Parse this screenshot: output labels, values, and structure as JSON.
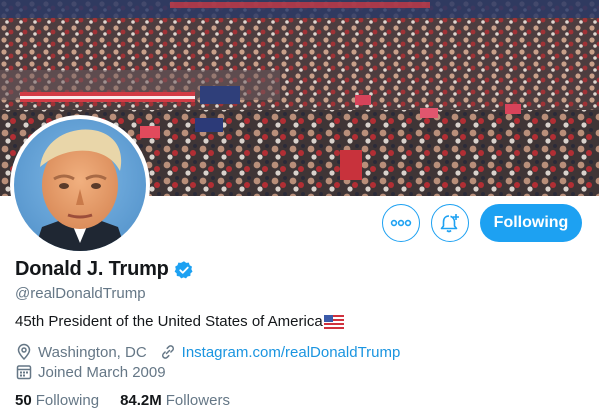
{
  "banner": {
    "image": "rally-crowd-banner"
  },
  "avatar": {
    "image": "profile-photo"
  },
  "actions": {
    "more_icon": "more-horizontal-icon",
    "notify_icon": "bell-plus-icon",
    "follow_label": "Following"
  },
  "profile": {
    "name": "Donald J. Trump",
    "verified": true,
    "handle": "@realDonaldTrump",
    "bio": "45th President of the United States of America",
    "bio_emoji": "us-flag-icon",
    "location": "Washington, DC",
    "website": "Instagram.com/realDonaldTrump",
    "joined": "Joined March 2009"
  },
  "stats": {
    "following_count": "50",
    "following_label": "Following",
    "followers_count": "84.2M",
    "followers_label": "Followers"
  },
  "colors": {
    "accent": "#1da1f2",
    "link": "#1b95e0",
    "secondary_text": "#657786",
    "primary_text": "#14171a"
  }
}
